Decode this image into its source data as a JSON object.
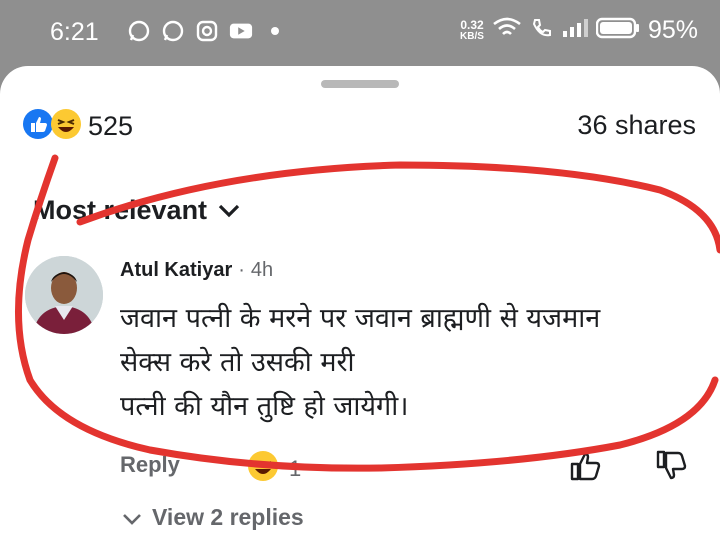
{
  "status_bar": {
    "time": "6:21",
    "net_speed_value": "0.32",
    "net_speed_unit": "KB/S",
    "battery": "95%"
  },
  "reactions": {
    "count": "525",
    "icons": [
      "like-icon",
      "laugh-icon"
    ]
  },
  "shares": "36 shares",
  "sort": {
    "label": "Most relevant"
  },
  "comment": {
    "author": "Atul Katiyar",
    "separator": "·",
    "time": "4h",
    "lines": [
      "जवान पत्नी के मरने पर जवान ब्राह्मणी से यजमान",
      "सेक्स करे तो उसकी मरी",
      "पत्नी की यौन तुष्टि हो जायेगी।"
    ],
    "reply_label": "Reply",
    "reaction_count": "1",
    "view_replies": "View 2 replies"
  },
  "colors": {
    "accent": "#1877f2",
    "scribble": "#e3342f",
    "status_bar": "#8f8f8f"
  }
}
